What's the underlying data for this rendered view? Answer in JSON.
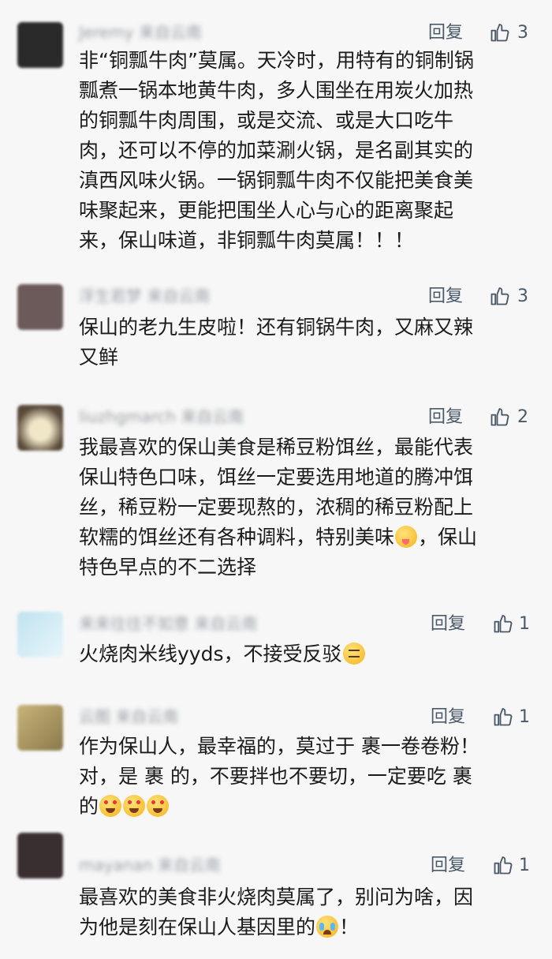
{
  "ui": {
    "reply_label": "回复"
  },
  "comments": [
    {
      "nickname": "Jeremy 来自云南",
      "likes": "3",
      "lines": [
        "非“铜瓢牛肉”莫属。天冷时，用特有的铜制锅",
        "瓢煮一锅本地黄牛肉，多人围坐在用炭火加热",
        "的铜瓢牛肉周围，或是交流、或是大口吃牛",
        "肉，还可以不停的加菜涮火锅，是名副其实的",
        "滇西风味火锅。一锅铜瓢牛肉不仅能把美食美",
        "味聚起来，更能把围坐人心与心的距离聚起",
        "来，保山味道，非铜瓢牛肉莫属！！！"
      ]
    },
    {
      "nickname": "浮生若梦 来自云南",
      "likes": "3",
      "lines": [
        "保山的老九生皮啦！还有铜锅牛肉，又麻又辣",
        "又鲜"
      ]
    },
    {
      "nickname": "liuzhgmarch 来自云南",
      "likes": "2",
      "lines": [
        "我最喜欢的保山美食是稀豆粉饵丝，最能代表",
        "保山特色口味，饵丝一定要选用地道的腾冲饵",
        "丝，稀豆粉一定要现熬的，浓稠的稀豆粉配上"
      ],
      "line4_before": "软糯的饵丝还有各种调料，特别美味",
      "line4_after": "，保山",
      "line5": "特色早点的不二选择",
      "emoji": "savoring-food-emoji"
    },
    {
      "nickname": "来来往往不如意 来自云南",
      "likes": "1",
      "text": "火烧肉米线yyds，不接受反驳",
      "emoji": "thinking-face-emoji"
    },
    {
      "nickname": "云图 来自云南",
      "likes": "1",
      "lines": [
        "作为保山人，最幸福的，莫过于 裹一卷卷粉！",
        "对，是 裹 的，不要拌也不要切，一定要吃 裹"
      ],
      "line3": "的",
      "emoji": "heart-eyes-emoji"
    },
    {
      "nickname": "mayanan 来自云南",
      "likes": "1",
      "line1": "最喜欢的美食非火烧肉莫属了，别问为啥，因",
      "line2_before": "为他是刻在保山人基因里的",
      "line2_after": "！",
      "emoji": "crying-face-emoji"
    }
  ],
  "colors": {
    "background": "#f7f7f7",
    "text": "#1b1b1b",
    "meta": "#4a5a6a"
  }
}
